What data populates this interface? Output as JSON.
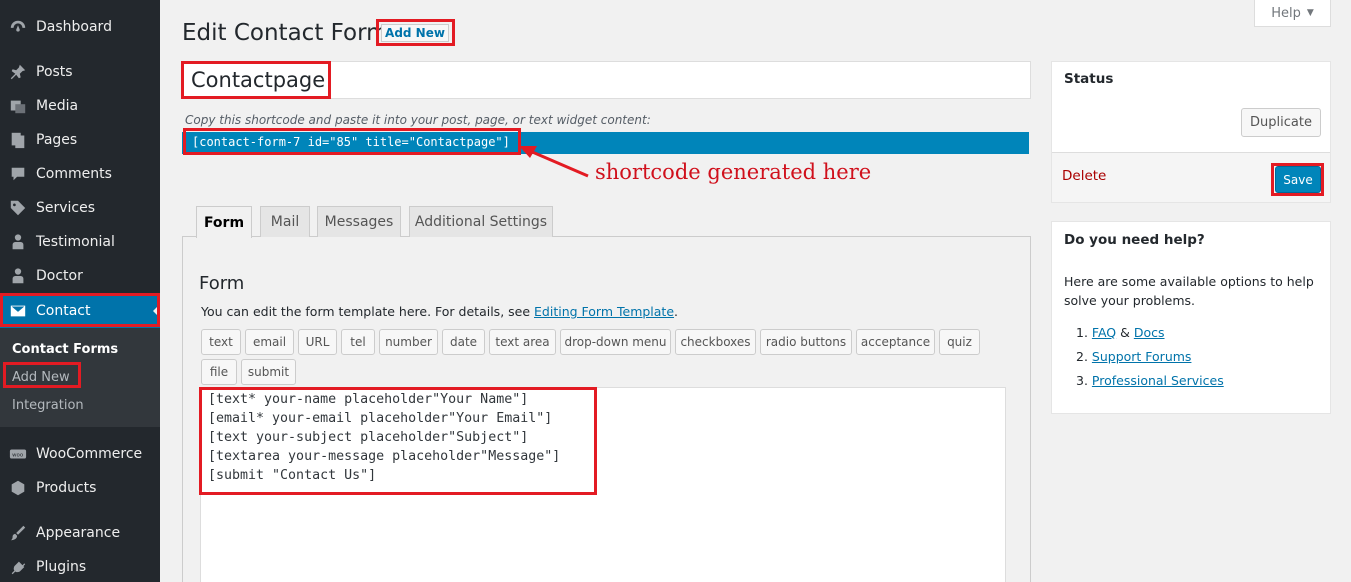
{
  "sidebar": {
    "items": [
      {
        "label": "Dashboard",
        "icon": "dashboard-icon"
      },
      {
        "label": "Posts",
        "icon": "pin-icon"
      },
      {
        "label": "Media",
        "icon": "media-icon"
      },
      {
        "label": "Pages",
        "icon": "pages-icon"
      },
      {
        "label": "Comments",
        "icon": "comment-icon"
      },
      {
        "label": "Services",
        "icon": "tag-icon"
      },
      {
        "label": "Testimonial",
        "icon": "person-icon"
      },
      {
        "label": "Doctor",
        "icon": "person-icon"
      },
      {
        "label": "Contact",
        "icon": "envelope-icon",
        "active": true
      },
      {
        "label": "WooCommerce",
        "icon": "woo-icon"
      },
      {
        "label": "Products",
        "icon": "box-icon"
      },
      {
        "label": "Appearance",
        "icon": "brush-icon"
      },
      {
        "label": "Plugins",
        "icon": "plug-icon"
      }
    ],
    "submenu": [
      "Contact Forms",
      "Add New",
      "Integration"
    ]
  },
  "header": {
    "title": "Edit Contact Form",
    "add_new": "Add New",
    "help": "Help"
  },
  "form_title": "Contactpage",
  "shortcode": {
    "hint": "Copy this shortcode and paste it into your post, page, or text widget content:",
    "code": "[contact-form-7 id=\"85\" title=\"Contactpage\"]"
  },
  "annotation": "shortcode generated here",
  "tabs": [
    "Form",
    "Mail",
    "Messages",
    "Additional Settings"
  ],
  "form_panel": {
    "heading": "Form",
    "desc_prefix": "You can edit the form template here. For details, see ",
    "desc_link": "Editing Form Template",
    "desc_suffix": ".",
    "tags": [
      "text",
      "email",
      "URL",
      "tel",
      "number",
      "date",
      "text area",
      "drop-down menu",
      "checkboxes",
      "radio buttons",
      "acceptance",
      "quiz",
      "file",
      "submit"
    ],
    "code_lines": [
      "[text* your-name placeholder\"Your Name\"]",
      "[email* your-email placeholder\"Your Email\"]",
      "[text your-subject placeholder\"Subject\"]",
      "[textarea your-message placeholder\"Message\"]",
      "[submit \"Contact Us\"]"
    ]
  },
  "status_box": {
    "title": "Status",
    "duplicate": "Duplicate",
    "delete": "Delete",
    "save": "Save"
  },
  "help_box": {
    "title": "Do you need help?",
    "text": "Here are some available options to help solve your problems.",
    "faq": "FAQ",
    "amp": "&",
    "docs": "Docs",
    "support": "Support Forums",
    "services": "Professional Services"
  },
  "colors": {
    "sidebar_bg": "#23282d",
    "accent": "#0073aa",
    "button_primary": "#0085ba",
    "highlight_red": "#e31b23"
  }
}
